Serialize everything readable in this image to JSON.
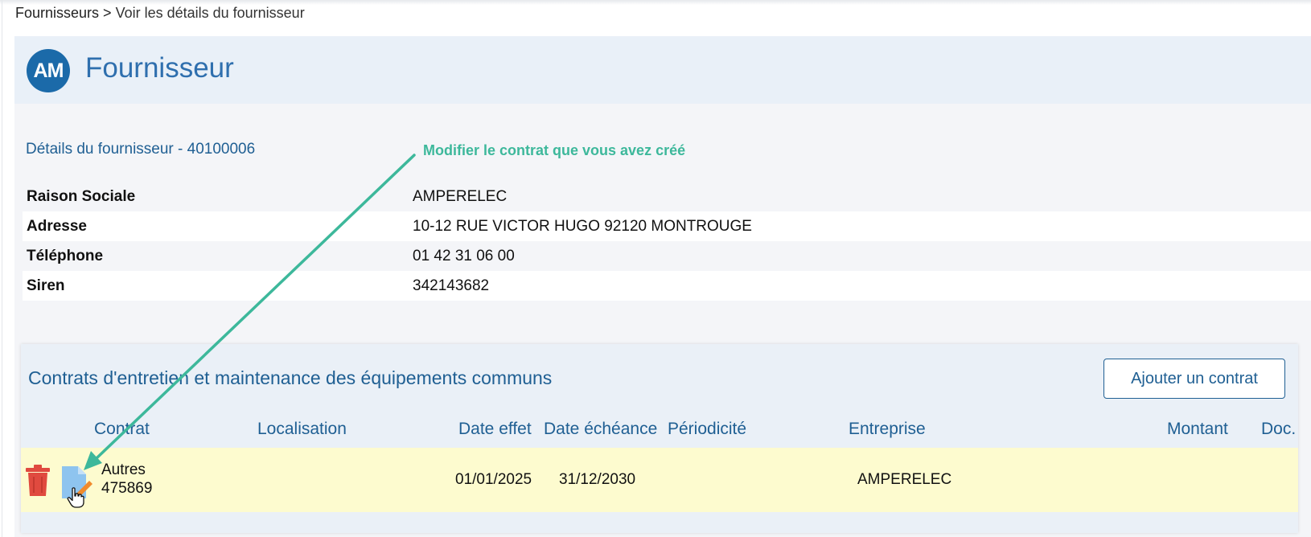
{
  "breadcrumb": {
    "root": "Fournisseurs",
    "separator": ">",
    "current": "Voir les détails du fournisseur"
  },
  "header": {
    "avatar_initials": "AM",
    "title": "Fournisseur"
  },
  "details": {
    "title": "Détails du fournisseur - 40100006",
    "rows": [
      {
        "label": "Raison Sociale",
        "value": "AMPERELEC"
      },
      {
        "label": "Adresse",
        "value": "10-12 RUE VICTOR HUGO 92120 MONTROUGE"
      },
      {
        "label": "Téléphone",
        "value": "01 42 31 06 00"
      },
      {
        "label": "Siren",
        "value": "342143682"
      }
    ]
  },
  "annotation": {
    "text": "Modifier le contrat que vous avez créé",
    "color": "#3db89b"
  },
  "contracts": {
    "title": "Contrats d'entretien et maintenance des équipements communs",
    "add_button": "Ajouter un contrat",
    "columns": [
      "Contrat",
      "Localisation",
      "Date effet",
      "Date échéance",
      "Périodicité",
      "Entreprise",
      "Montant",
      "Doc."
    ],
    "rows": [
      {
        "type": "Autres",
        "number": "475869",
        "localisation": "",
        "date_effet": "01/01/2025",
        "date_echeance": "31/12/2030",
        "periodicite": "",
        "entreprise": "AMPERELEC",
        "montant": "",
        "doc": "",
        "actions": [
          "delete-icon",
          "edit-document-icon"
        ]
      }
    ]
  },
  "colors": {
    "accent": "#1f5f93",
    "avatar": "#1b6aa9",
    "row_highlight": "#fdfbcf",
    "delete": "#e04a3f",
    "edit": "#8ec4ef"
  }
}
